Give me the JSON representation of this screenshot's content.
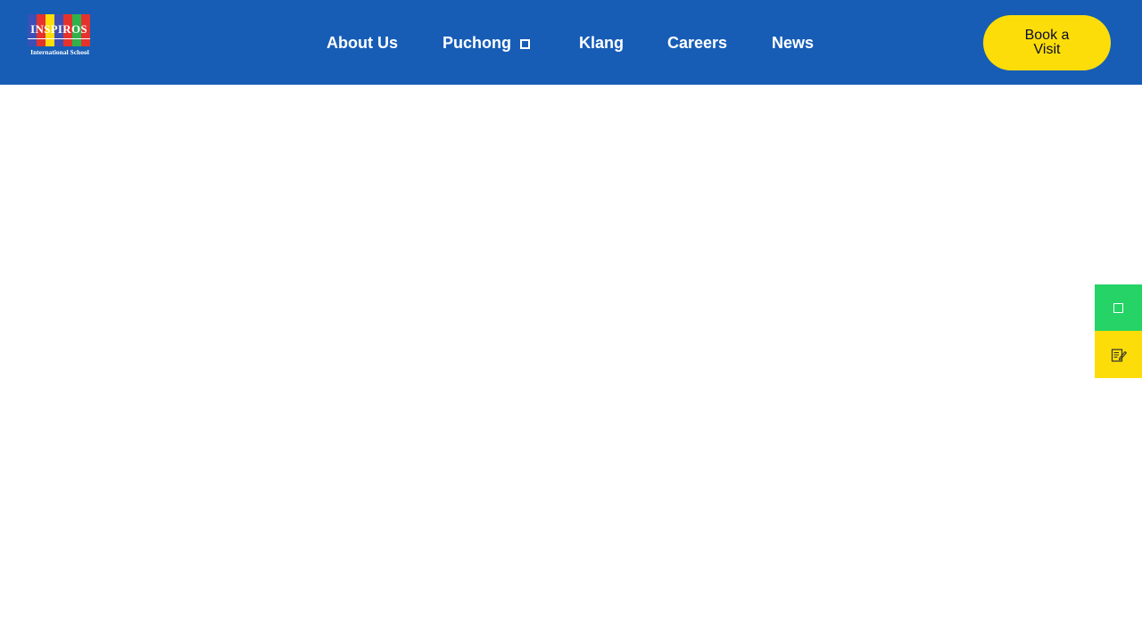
{
  "header": {
    "background": "#175DB6",
    "logo": {
      "word": "INSPIROS",
      "sub": "International School",
      "block_colors": [
        "#3B4FB8",
        "#E5322D",
        "#FCDD09",
        "#3B4FB8",
        "#E5322D",
        "#2EB24B",
        "#E5322D"
      ]
    },
    "nav": [
      {
        "label": "About Us"
      },
      {
        "label": "Puchong",
        "has_dropdown": true,
        "icon": "square-dropdown-icon"
      },
      {
        "label": "Klang"
      },
      {
        "label": "Careers"
      },
      {
        "label": "News"
      }
    ],
    "cta": {
      "label": "Book a Visit",
      "color": "#FCDD09"
    }
  },
  "side_buttons": {
    "whatsapp": {
      "icon": "square-icon",
      "color": "#25D366"
    },
    "enquiry": {
      "icon": "edit-form-icon",
      "color": "#FCDD09"
    }
  }
}
